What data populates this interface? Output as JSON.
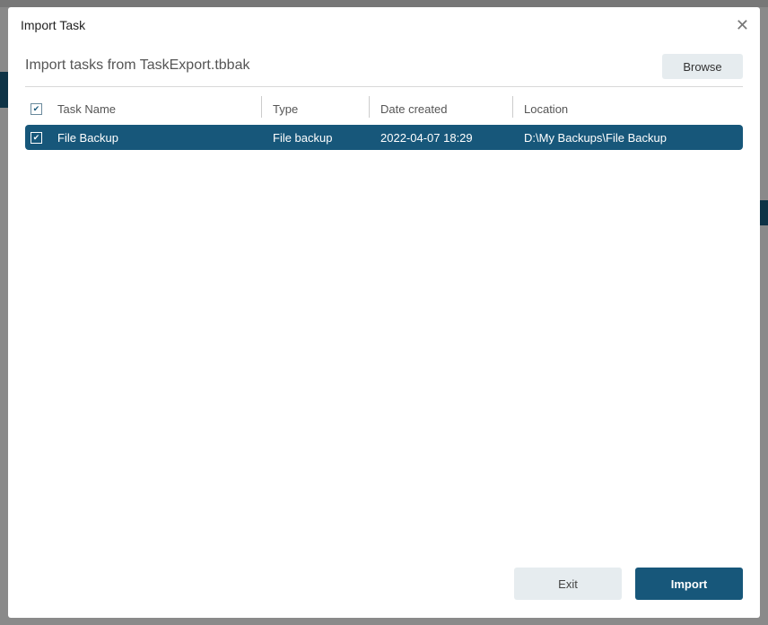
{
  "dialog": {
    "title": "Import Task",
    "heading": "Import tasks from TaskExport.tbbak",
    "browse_label": "Browse",
    "exit_label": "Exit",
    "import_label": "Import"
  },
  "table": {
    "columns": [
      "Task Name",
      "Type",
      "Date created",
      "Location"
    ],
    "rows": [
      {
        "name": "File Backup",
        "type": "File backup",
        "date": "2022-04-07 18:29",
        "location": "D:\\My Backups\\File Backup",
        "checked": true
      }
    ]
  },
  "colors": {
    "accent": "#17577a"
  }
}
